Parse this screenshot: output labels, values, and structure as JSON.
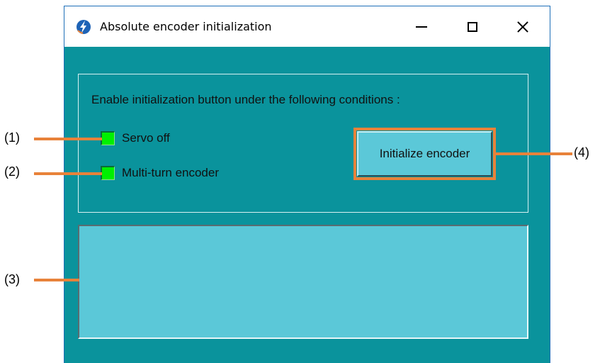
{
  "window": {
    "title": "Absolute encoder initialization",
    "app_icon": "lightning-bolt-icon",
    "controls": [
      "minimize-icon",
      "maximize-icon",
      "close-icon"
    ]
  },
  "conditions": {
    "heading": "Enable initialization button under the following conditions :",
    "items": [
      {
        "label": "Servo off",
        "indicator_color": "#00f000"
      },
      {
        "label": "Multi-turn encoder",
        "indicator_color": "#00f000"
      }
    ]
  },
  "actions": {
    "initialize_label": "Initialize encoder"
  },
  "message_box": {
    "text": ""
  },
  "callouts": [
    "(1)",
    "(2)",
    "(3)",
    "(4)"
  ],
  "colors": {
    "window_bg": "#0a939c",
    "panel_bg": "#5bc8d8",
    "highlight": "#e8823a",
    "indicator_on": "#00f000"
  }
}
